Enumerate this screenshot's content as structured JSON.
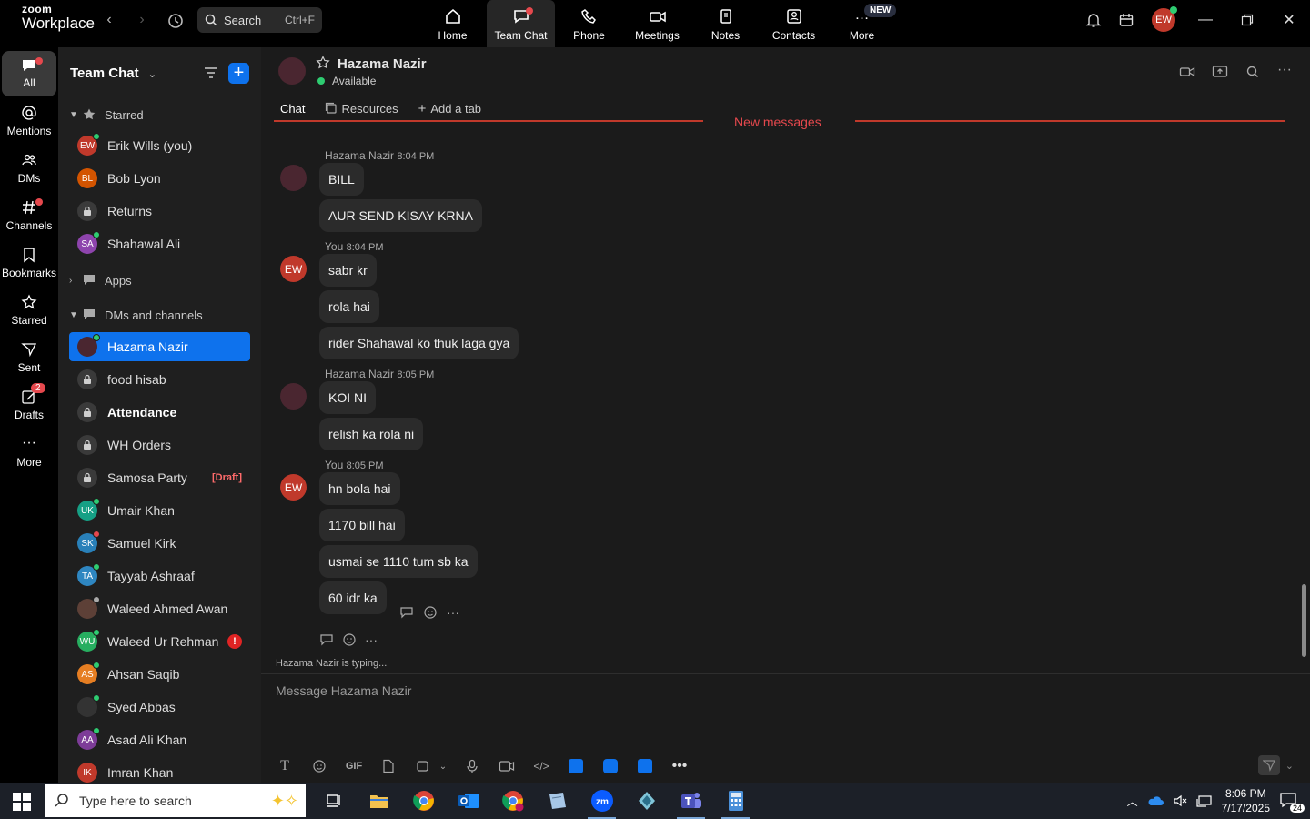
{
  "app": {
    "brand_small": "zoom",
    "brand": "Workplace"
  },
  "search": {
    "label": "Search",
    "shortcut": "Ctrl+F"
  },
  "topnav": [
    {
      "label": "Home",
      "icon": "home-icon"
    },
    {
      "label": "Team Chat",
      "icon": "chat-icon",
      "active": true
    },
    {
      "label": "Phone",
      "icon": "phone-icon"
    },
    {
      "label": "Meetings",
      "icon": "video-icon"
    },
    {
      "label": "Notes",
      "icon": "notes-icon"
    },
    {
      "label": "Contacts",
      "icon": "contacts-icon"
    },
    {
      "label": "More",
      "icon": "more-icon",
      "badge": "NEW"
    }
  ],
  "user": {
    "initials": "EW"
  },
  "rail": [
    {
      "label": "All",
      "icon": "chat-bubble-icon"
    },
    {
      "label": "Mentions",
      "icon": "at-icon"
    },
    {
      "label": "DMs",
      "icon": "people-icon"
    },
    {
      "label": "Channels",
      "icon": "hash-icon"
    },
    {
      "label": "Bookmarks",
      "icon": "bookmark-icon"
    },
    {
      "label": "Starred",
      "icon": "star-icon"
    },
    {
      "label": "Sent",
      "icon": "send-icon"
    },
    {
      "label": "Drafts",
      "icon": "draft-icon",
      "badge": "2"
    },
    {
      "label": "More",
      "icon": "more-dots-icon"
    }
  ],
  "sidebar": {
    "title": "Team Chat",
    "sections": {
      "starred": "Starred",
      "apps": "Apps",
      "dms": "DMs and channels"
    },
    "starred": [
      {
        "name": "Erik Wills (you)",
        "initials": "EW",
        "color": "#c0392b",
        "status": "#2ecc71"
      },
      {
        "name": "Bob Lyon",
        "initials": "BL",
        "color": "#d35400",
        "status": ""
      },
      {
        "name": "Returns",
        "type": "channel"
      },
      {
        "name": "Shahawal Ali",
        "initials": "SA",
        "color": "#8e44ad",
        "status": "#2ecc71"
      }
    ],
    "dms": [
      {
        "name": "Hazama Nazir",
        "type": "photo",
        "color": "#4a2630",
        "status": "#2ecc71",
        "selected": true
      },
      {
        "name": "food hisab",
        "type": "channel"
      },
      {
        "name": "Attendance",
        "type": "channel",
        "bold": true
      },
      {
        "name": "WH Orders",
        "type": "channel"
      },
      {
        "name": "Samosa Party",
        "type": "channel",
        "tag": "[Draft]"
      },
      {
        "name": "Umair Khan",
        "initials": "UK",
        "color": "#16a085",
        "status": "#2ecc71"
      },
      {
        "name": "Samuel Kirk",
        "initials": "SK",
        "color": "#2980b9",
        "status": "#e5484d"
      },
      {
        "name": "Tayyab Ashraaf",
        "initials": "TA",
        "color": "#2e86c1",
        "status": "#2ecc71"
      },
      {
        "name": "Waleed Ahmed Awan",
        "type": "photo",
        "color": "#5d4037",
        "status": "#aaaaaa"
      },
      {
        "name": "Waleed Ur Rehman",
        "initials": "WU",
        "color": "#27ae60",
        "status": "#2ecc71",
        "alert": "!"
      },
      {
        "name": "Ahsan Saqib",
        "initials": "AS",
        "color": "#e67e22",
        "status": "#2ecc71"
      },
      {
        "name": "Syed Abbas",
        "type": "photo",
        "color": "#333333",
        "status": "#2ecc71"
      },
      {
        "name": "Asad Ali Khan",
        "initials": "AA",
        "color": "#7d3c98",
        "status": "#2ecc71"
      },
      {
        "name": "Imran Khan",
        "initials": "IK",
        "color": "#c0392b",
        "status": ""
      }
    ]
  },
  "chat": {
    "name": "Hazama Nazir",
    "status": "Available",
    "tabs": [
      "Chat",
      "Resources",
      "Add a tab"
    ],
    "new_messages": "New messages",
    "groups": [
      {
        "sender": "Hazama Nazir",
        "time": "8:04 PM",
        "self": false,
        "messages": [
          "BILL",
          "AUR SEND KISAY KRNA"
        ]
      },
      {
        "sender": "You",
        "time": "8:04 PM",
        "self": true,
        "messages": [
          "sabr kr",
          "rola hai",
          "rider Shahawal ko thuk laga gya"
        ]
      },
      {
        "sender": "Hazama Nazir",
        "time": "8:05 PM",
        "self": false,
        "messages": [
          "KOI NI",
          "relish ka rola ni"
        ]
      },
      {
        "sender": "You",
        "time": "8:05 PM",
        "self": true,
        "messages": [
          "hn bola hai",
          "1170 bill hai",
          "usmai se 1110 tum sb ka",
          "60 idr ka"
        ]
      }
    ],
    "typing": "Hazama Nazir  is typing..."
  },
  "compose": {
    "placeholder": "Message Hazama Nazir",
    "gif": "GIF"
  },
  "taskbar": {
    "search_placeholder": "Type here to search",
    "time": "8:06 PM",
    "date": "7/17/2025",
    "notif_count": "24"
  }
}
